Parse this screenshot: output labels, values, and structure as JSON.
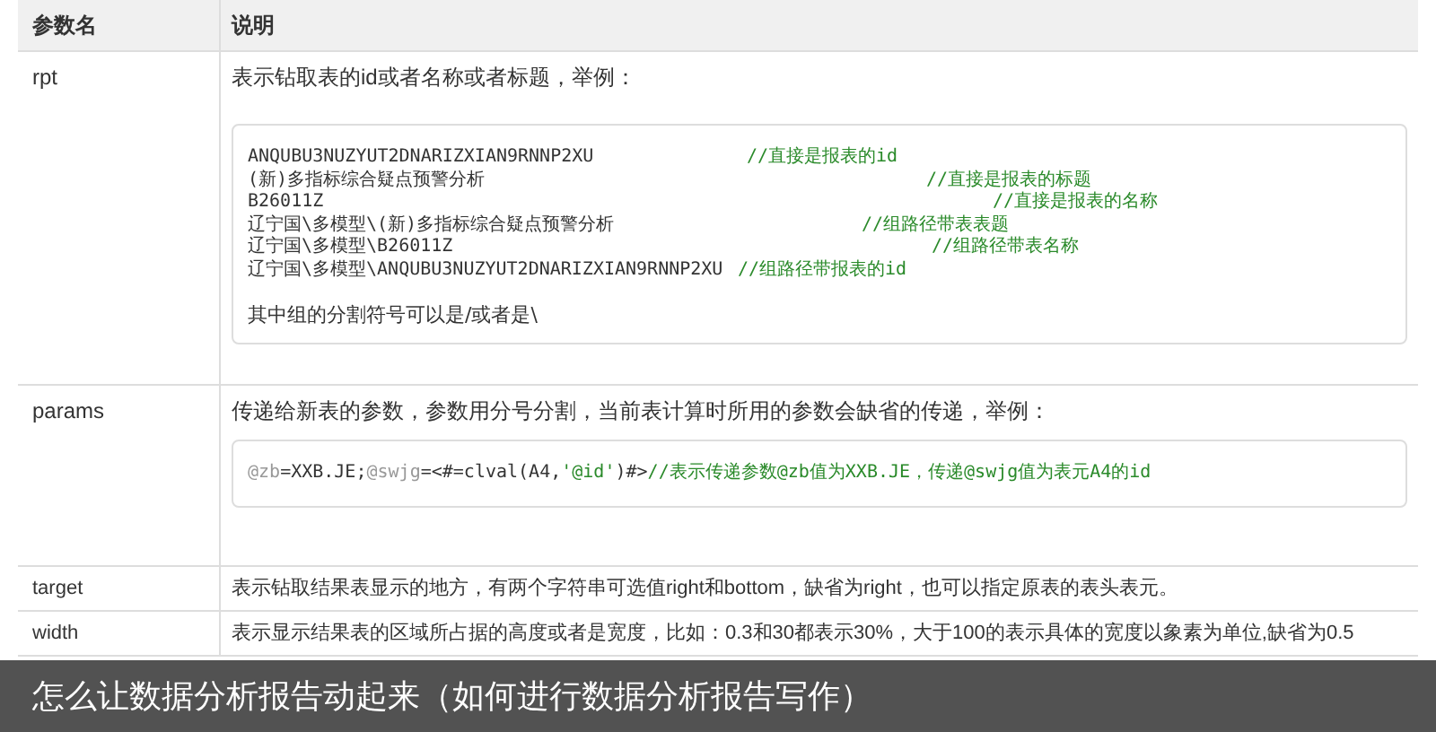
{
  "table": {
    "columns": [
      "参数名",
      "说明"
    ],
    "rows": [
      {
        "name": "rpt",
        "description": "表示钻取表的id或者名称或者标题，举例：",
        "code": {
          "lines": [
            {
              "code": "ANQUBU3NUZYUT2DNARIZXIAN9RNNP2XU",
              "comment": "//直接是报表的id"
            },
            {
              "code": "(新)多指标综合疑点预警分析",
              "comment": "//直接是报表的标题"
            },
            {
              "code": "B26011Z",
              "comment": "//直接是报表的名称"
            },
            {
              "code": "辽宁国\\多模型\\(新)多指标综合疑点预警分析",
              "comment": "//组路径带表表题"
            },
            {
              "code": "辽宁国\\多模型\\B26011Z",
              "comment": "//组路径带表名称"
            },
            {
              "code": "辽宁国\\多模型\\ANQUBU3NUZYUT2DNARIZXIAN9RNNP2XU",
              "comment": "//组路径带报表的id"
            }
          ],
          "note": "其中组的分割符号可以是/或者是\\"
        }
      },
      {
        "name": "params",
        "description": "传递给新表的参数，参数用分号分割，当前表计算时所用的参数会缺省的传递，举例：",
        "segments": [
          {
            "kind": "var",
            "text": "@zb"
          },
          {
            "kind": "plain",
            "text": "=XXB.JE;"
          },
          {
            "kind": "var",
            "text": "@swjg"
          },
          {
            "kind": "plain",
            "text": "=<#=clval(A4,"
          },
          {
            "kind": "string",
            "text": "'@id'"
          },
          {
            "kind": "plain",
            "text": ")#>"
          },
          {
            "kind": "comment",
            "text": "//表示传递参数@zb值为XXB.JE，传递@swjg值为表元A4的id"
          }
        ]
      },
      {
        "name": "target",
        "description": "表示钻取结果表显示的地方，有两个字符串可选值right和bottom，缺省为right，也可以指定原表的表头表元。"
      },
      {
        "name": "width",
        "description": "表示显示结果表的区域所占据的高度或者是宽度，比如：0.3和30都表示30%，大于100的表示具体的宽度以象素为单位,缺省为0.5"
      }
    ]
  },
  "caption": "怎么让数据分析报告动起来（如何进行数据分析报告写作）"
}
